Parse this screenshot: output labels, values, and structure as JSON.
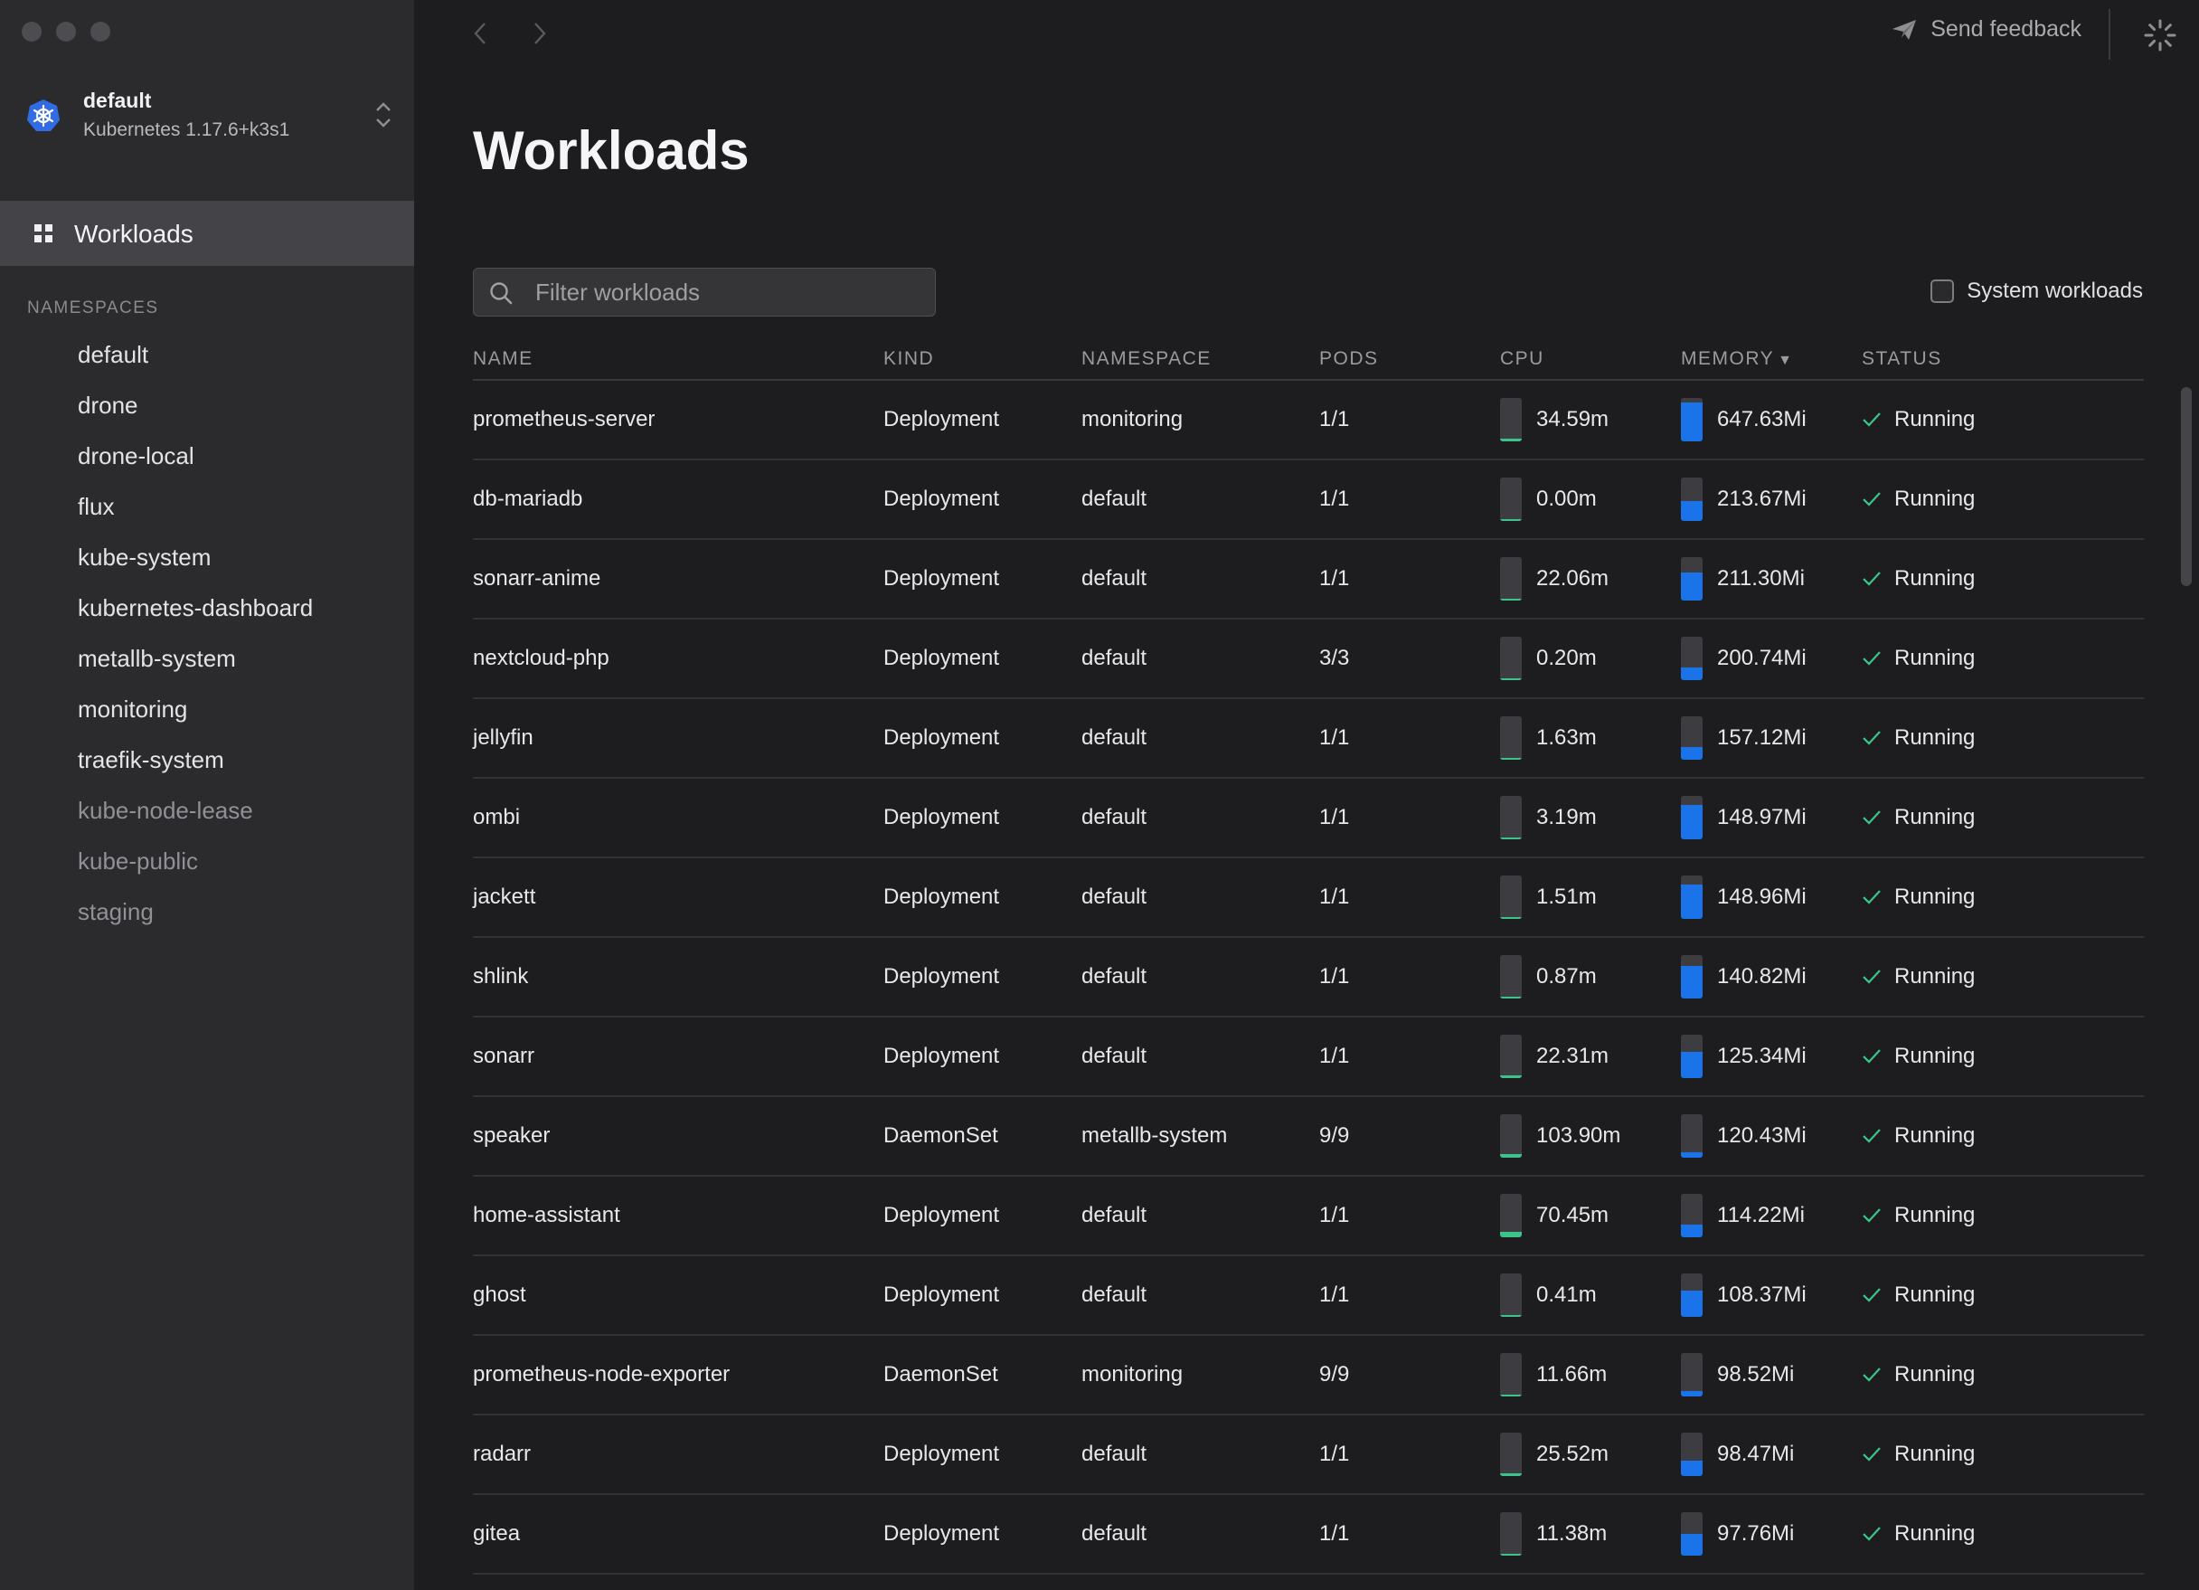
{
  "cluster": {
    "name": "default",
    "version": "Kubernetes 1.17.6+k3s1"
  },
  "nav": {
    "active_label": "Workloads"
  },
  "namespaces": {
    "heading": "NAMESPACES",
    "items": [
      {
        "label": "default",
        "dim": false
      },
      {
        "label": "drone",
        "dim": false
      },
      {
        "label": "drone-local",
        "dim": false
      },
      {
        "label": "flux",
        "dim": false
      },
      {
        "label": "kube-system",
        "dim": false
      },
      {
        "label": "kubernetes-dashboard",
        "dim": false
      },
      {
        "label": "metallb-system",
        "dim": false
      },
      {
        "label": "monitoring",
        "dim": false
      },
      {
        "label": "traefik-system",
        "dim": false
      },
      {
        "label": "kube-node-lease",
        "dim": true
      },
      {
        "label": "kube-public",
        "dim": true
      },
      {
        "label": "staging",
        "dim": true
      }
    ]
  },
  "toolbar": {
    "feedback_label": "Send feedback"
  },
  "page": {
    "title": "Workloads"
  },
  "filter": {
    "placeholder": "Filter workloads"
  },
  "system_toggle": {
    "label": "System workloads",
    "checked": false
  },
  "colors": {
    "cpu_bar": "#3cc48a",
    "mem_bar": "#1a73e8",
    "status_ok": "#3cc48a"
  },
  "table": {
    "headers": {
      "name": "NAME",
      "kind": "KIND",
      "namespace": "NAMESPACE",
      "pods": "PODS",
      "cpu": "CPU",
      "memory": "MEMORY",
      "status": "STATUS"
    },
    "rows": [
      {
        "name": "prometheus-server",
        "kind": "Deployment",
        "namespace": "monitoring",
        "pods": "1/1",
        "cpu": "34.59m",
        "cpu_level": 0.06,
        "memory": "647.63Mi",
        "mem_level": 0.9,
        "status": "Running"
      },
      {
        "name": "db-mariadb",
        "kind": "Deployment",
        "namespace": "default",
        "pods": "1/1",
        "cpu": "0.00m",
        "cpu_level": 0.0,
        "memory": "213.67Mi",
        "mem_level": 0.45,
        "status": "Running"
      },
      {
        "name": "sonarr-anime",
        "kind": "Deployment",
        "namespace": "default",
        "pods": "1/1",
        "cpu": "22.06m",
        "cpu_level": 0.05,
        "memory": "211.30Mi",
        "mem_level": 0.65,
        "status": "Running"
      },
      {
        "name": "nextcloud-php",
        "kind": "Deployment",
        "namespace": "default",
        "pods": "3/3",
        "cpu": "0.20m",
        "cpu_level": 0.02,
        "memory": "200.74Mi",
        "mem_level": 0.3,
        "status": "Running"
      },
      {
        "name": "jellyfin",
        "kind": "Deployment",
        "namespace": "default",
        "pods": "1/1",
        "cpu": "1.63m",
        "cpu_level": 0.03,
        "memory": "157.12Mi",
        "mem_level": 0.3,
        "status": "Running"
      },
      {
        "name": "ombi",
        "kind": "Deployment",
        "namespace": "default",
        "pods": "1/1",
        "cpu": "3.19m",
        "cpu_level": 0.03,
        "memory": "148.97Mi",
        "mem_level": 0.8,
        "status": "Running"
      },
      {
        "name": "jackett",
        "kind": "Deployment",
        "namespace": "default",
        "pods": "1/1",
        "cpu": "1.51m",
        "cpu_level": 0.03,
        "memory": "148.96Mi",
        "mem_level": 0.8,
        "status": "Running"
      },
      {
        "name": "shlink",
        "kind": "Deployment",
        "namespace": "default",
        "pods": "1/1",
        "cpu": "0.87m",
        "cpu_level": 0.02,
        "memory": "140.82Mi",
        "mem_level": 0.75,
        "status": "Running"
      },
      {
        "name": "sonarr",
        "kind": "Deployment",
        "namespace": "default",
        "pods": "1/1",
        "cpu": "22.31m",
        "cpu_level": 0.06,
        "memory": "125.34Mi",
        "mem_level": 0.6,
        "status": "Running"
      },
      {
        "name": "speaker",
        "kind": "DaemonSet",
        "namespace": "metallb-system",
        "pods": "9/9",
        "cpu": "103.90m",
        "cpu_level": 0.08,
        "memory": "120.43Mi",
        "mem_level": 0.12,
        "status": "Running"
      },
      {
        "name": "home-assistant",
        "kind": "Deployment",
        "namespace": "default",
        "pods": "1/1",
        "cpu": "70.45m",
        "cpu_level": 0.12,
        "memory": "114.22Mi",
        "mem_level": 0.3,
        "status": "Running"
      },
      {
        "name": "ghost",
        "kind": "Deployment",
        "namespace": "default",
        "pods": "1/1",
        "cpu": "0.41m",
        "cpu_level": 0.02,
        "memory": "108.37Mi",
        "mem_level": 0.6,
        "status": "Running"
      },
      {
        "name": "prometheus-node-exporter",
        "kind": "DaemonSet",
        "namespace": "monitoring",
        "pods": "9/9",
        "cpu": "11.66m",
        "cpu_level": 0.04,
        "memory": "98.52Mi",
        "mem_level": 0.12,
        "status": "Running"
      },
      {
        "name": "radarr",
        "kind": "Deployment",
        "namespace": "default",
        "pods": "1/1",
        "cpu": "25.52m",
        "cpu_level": 0.06,
        "memory": "98.47Mi",
        "mem_level": 0.35,
        "status": "Running"
      },
      {
        "name": "gitea",
        "kind": "Deployment",
        "namespace": "default",
        "pods": "1/1",
        "cpu": "11.38m",
        "cpu_level": 0.04,
        "memory": "97.76Mi",
        "mem_level": 0.5,
        "status": "Running"
      }
    ]
  }
}
